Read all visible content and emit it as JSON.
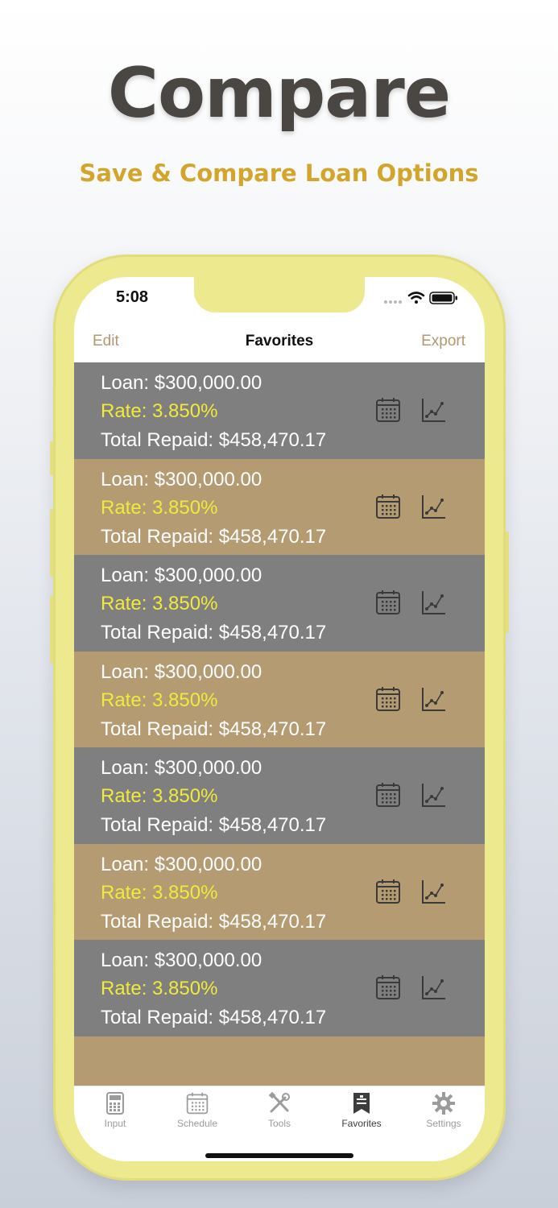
{
  "promo": {
    "headline": "Compare",
    "subheadline": "Save & Compare Loan Options"
  },
  "status_bar": {
    "time": "5:08",
    "icons": [
      "signal-icon",
      "wifi-icon",
      "battery-icon"
    ]
  },
  "nav": {
    "left": "Edit",
    "title": "Favorites",
    "right": "Export"
  },
  "favorites": [
    {
      "loan": "Loan: $300,000.00",
      "rate": "Rate: 3.850%",
      "total": "Total Repaid: $458,470.17"
    },
    {
      "loan": "Loan: $300,000.00",
      "rate": "Rate: 3.850%",
      "total": "Total Repaid: $458,470.17"
    },
    {
      "loan": "Loan: $300,000.00",
      "rate": "Rate: 3.850%",
      "total": "Total Repaid: $458,470.17"
    },
    {
      "loan": "Loan: $300,000.00",
      "rate": "Rate: 3.850%",
      "total": "Total Repaid: $458,470.17"
    },
    {
      "loan": "Loan: $300,000.00",
      "rate": "Rate: 3.850%",
      "total": "Total Repaid: $458,470.17"
    },
    {
      "loan": "Loan: $300,000.00",
      "rate": "Rate: 3.850%",
      "total": "Total Repaid: $458,470.17"
    },
    {
      "loan": "Loan: $300,000.00",
      "rate": "Rate: 3.850%",
      "total": "Total Repaid: $458,470.17"
    }
  ],
  "row_icons": [
    "calendar-icon",
    "chart-icon"
  ],
  "tabs": [
    {
      "label": "Input",
      "icon": "calculator-icon",
      "active": false
    },
    {
      "label": "Schedule",
      "icon": "calendar-icon",
      "active": false
    },
    {
      "label": "Tools",
      "icon": "tools-icon",
      "active": false
    },
    {
      "label": "Favorites",
      "icon": "bookmark-icon",
      "active": true
    },
    {
      "label": "Settings",
      "icon": "gear-icon",
      "active": false
    }
  ],
  "colors": {
    "headline": "#4a4642",
    "subheadline": "#d4a52b",
    "frame": "#ede98f",
    "row_gray": "#7f7f7f",
    "row_tan": "#b49b72",
    "rate_text": "#f0ea3c",
    "nav_accent": "#b4976d"
  }
}
